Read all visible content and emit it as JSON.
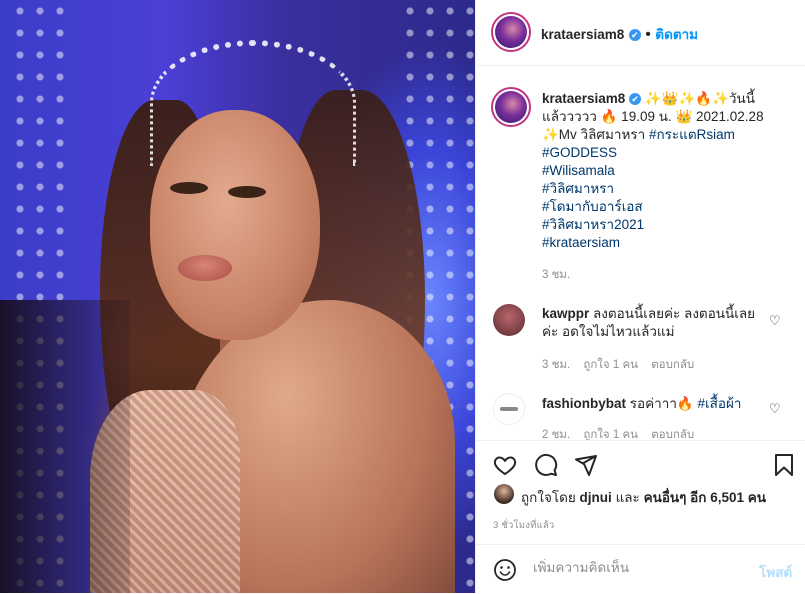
{
  "post": {
    "username": "krataersiam8",
    "follow_label": "ติดตาม",
    "separator": "•",
    "verified_mark": "✔"
  },
  "caption": {
    "line1_text": "✨👑✨🔥✨วันนี้",
    "line2_text": "แล้ววววว 🔥 19.09 น. 👑 2021.02.28",
    "line3_prefix": "✨Mv วิลิศมาหรา",
    "line3_tag": "#กระแตRsiam",
    "tags": [
      "#GODDESS",
      "#Wilisamala",
      "#วิลิศมาหรา",
      "#โดมากับอาร์เอส",
      "#วิลิศมาหรา2021",
      "#krataersiam"
    ],
    "time": "3 ชม."
  },
  "comments": [
    {
      "username": "kawppr",
      "text": "ลงตอนนี้เลยค่ะ ลงตอนนี้เลยค่ะ อดใจไม่ไหวแล้วแม่",
      "time": "3 ชม.",
      "likes": "ถูกใจ 1 คน",
      "reply": "ตอบกลับ"
    },
    {
      "username": "fashionbybat",
      "text": "รอค่าาา🔥",
      "tag": "#เสื้อผ้า",
      "time": "2 ชม.",
      "likes": "ถูกใจ 1 คน",
      "reply": "ตอบกลับ"
    }
  ],
  "likes": {
    "prefix": "ถูกใจโดย",
    "user": "djnui",
    "middle": "และ",
    "others": "คนอื่นๆ อีก 6,501 คน"
  },
  "time_ago": "3 ชั่วโมงที่แล้ว",
  "add_comment": {
    "placeholder": "เพิ่มความคิดเห็น",
    "post_label": "โพสต์"
  },
  "icons": {
    "heart": "heart-icon",
    "comment": "comment-icon",
    "share": "share-icon",
    "save": "bookmark-icon",
    "emoji": "emoji-icon"
  },
  "colors": {
    "accent": "#0095f6",
    "hashtag": "#00376b",
    "muted": "#8e8e8e"
  }
}
